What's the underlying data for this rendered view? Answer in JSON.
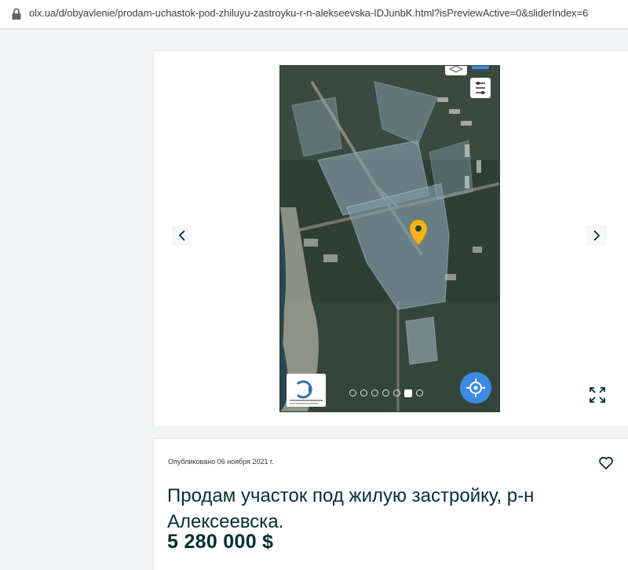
{
  "browser": {
    "url": "olx.ua/d/obyavlenie/prodam-uchastok-pod-zhiluyu-zastroyku-r-n-alekseevska-IDJunbK.html?isPreviewActive=0&sliderIndex=6"
  },
  "gallery": {
    "prev_icon": "chevron-left-icon",
    "next_icon": "chevron-right-icon",
    "fullscreen_icon": "expand-icon",
    "slide_count": 7,
    "active_slide": 6,
    "map_marker_color": "#f5b41e",
    "locate_button_color": "#3d8ae5"
  },
  "ad": {
    "published": "Опубликовано 06 ноября 2021 г.",
    "title": "Продам участок под жилую застройку, р-н Алексеевска.",
    "price": "5 280 000 $",
    "favorite_icon": "heart-icon"
  },
  "colors": {
    "text_primary": "#002f34",
    "page_bg": "#f2f4f5"
  }
}
